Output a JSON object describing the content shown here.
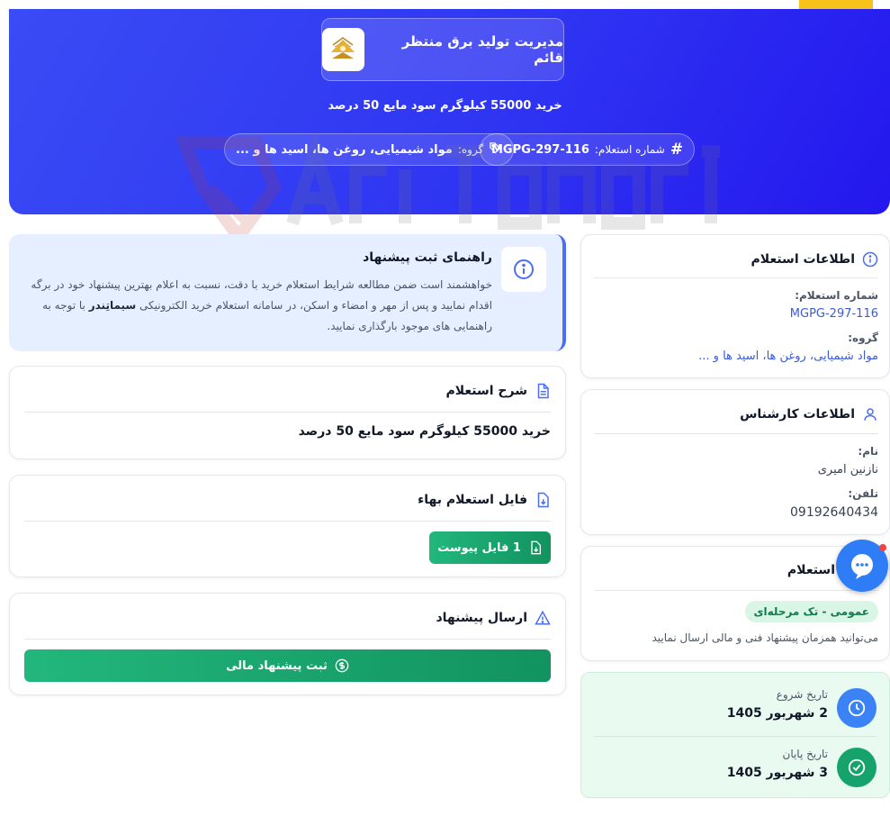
{
  "header": {
    "org_name": "مدیریت تولید برق منتظر قائم",
    "subtitle": "خرید 55000 کیلوگرم سود مایع 50 درصد",
    "inquiry_number_label": "شماره استعلام:",
    "inquiry_number": "MGPG-297-116",
    "group_label": "گروه:",
    "group_value": "مواد شیمیایی، روغن ها، اسید ها و ..."
  },
  "guide": {
    "title": "راهنمای ثبت پیشنهاد",
    "text_part1": "خواهشمند است ضمن مطالعه شرایط استعلام خرید با دقت، نسبت به اعلام بهترین پیشنهاد خود در برگه اقدام نمایید و پس از مهر و امضاء و اسکن، در سامانه استعلام خرید الکترونیکی ",
    "text_bold": "سیماتِندر",
    "text_part2": " با توجه به راهنمایی های موجود بارگذاری نمایید."
  },
  "description": {
    "title": "شرح استعلام",
    "text": "خرید 55000 کیلوگرم سود مایع 50 درصد"
  },
  "price_file": {
    "title": "فایل استعلام بهاء",
    "button_label": "1 فایل پیوست"
  },
  "send_offer": {
    "title": "ارسال پیشنهاد",
    "button_label": "ثبت پیشنهاد مالی"
  },
  "inquiry_info": {
    "title": "اطلاعات استعلام",
    "number_label": "شماره استعلام:",
    "number_value": "MGPG-297-116",
    "group_label": "گروه:",
    "group_value": "مواد شیمیایی، روغن ها، اسید ها و ..."
  },
  "expert_info": {
    "title": "اطلاعات کارشناس",
    "name_label": "نام:",
    "name_value": "نازنین امیری",
    "phone_label": "تلفن:",
    "phone_value": "09192640434"
  },
  "inquiry_type": {
    "title": "استعلام",
    "badge": "عمومی - تک مرحله‌ای",
    "note": "می‌توانید همزمان پیشنهاد فنی و مالی ارسال نمایید"
  },
  "dates": {
    "start_label": "تاریخ شروع",
    "start_value": "2 شهریور 1405",
    "end_label": "تاریخ پایان",
    "end_value": "3 شهریور 1405"
  },
  "colors": {
    "hero_blue": "#2f35f2",
    "accent_yellow": "#f7c21a",
    "primary_green": "#16a36b",
    "link_blue": "#3b5bdb"
  },
  "icons": [
    "hash-icon",
    "tag-icon",
    "info-icon",
    "document-icon",
    "file-download-icon",
    "warning-triangle-icon",
    "dollar-icon",
    "user-icon",
    "clock-icon",
    "check-circle-icon",
    "chat-icon"
  ]
}
